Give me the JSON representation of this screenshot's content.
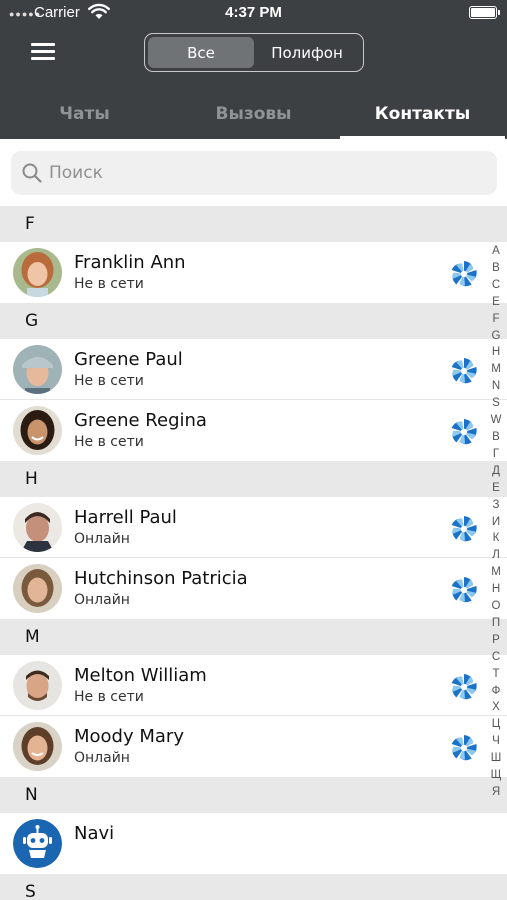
{
  "status_bar": {
    "carrier": "Carrier",
    "time": "4:37 PM"
  },
  "segment": {
    "all": "Все",
    "polifon": "Полифон"
  },
  "tabs": {
    "chats": "Чаты",
    "calls": "Вызовы",
    "contacts": "Контакты"
  },
  "search": {
    "placeholder": "Поиск"
  },
  "sections": {
    "f": {
      "letter": "F",
      "contacts": [
        {
          "name": "Franklin Ann",
          "status": "Не в сети"
        }
      ]
    },
    "g": {
      "letter": "G",
      "contacts": [
        {
          "name": "Greene Paul",
          "status": "Не в сети"
        },
        {
          "name": "Greene Regina",
          "status": "Не в сети"
        }
      ]
    },
    "h": {
      "letter": "H",
      "contacts": [
        {
          "name": "Harrell Paul",
          "status": "Онлайн"
        },
        {
          "name": "Hutchinson Patricia",
          "status": "Онлайн"
        }
      ]
    },
    "m": {
      "letter": "M",
      "contacts": [
        {
          "name": "Melton William",
          "status": "Не в сети"
        },
        {
          "name": "Moody Mary",
          "status": "Онлайн"
        }
      ]
    },
    "n": {
      "letter": "N",
      "contacts": [
        {
          "name": "Navi"
        }
      ]
    },
    "s": {
      "letter": "S"
    }
  },
  "index_letters": [
    "A",
    "B",
    "C",
    "E",
    "F",
    "G",
    "H",
    "M",
    "N",
    "S",
    "W",
    "В",
    "Г",
    "Д",
    "Е",
    "З",
    "И",
    "К",
    "Л",
    "М",
    "Н",
    "О",
    "П",
    "Р",
    "С",
    "Т",
    "Ф",
    "Х",
    "Ц",
    "Ч",
    "Ш",
    "Щ",
    "Я"
  ],
  "icons": {
    "menu": "hamburger-menu-icon",
    "search": "search-icon",
    "badge": "polifon-app-icon",
    "bot": "navi-bot-icon"
  },
  "colors": {
    "header": "#3d4043",
    "segment_active": "#707376",
    "badge_blue": "#1b73c9",
    "section_bg": "#e8e8e8"
  }
}
